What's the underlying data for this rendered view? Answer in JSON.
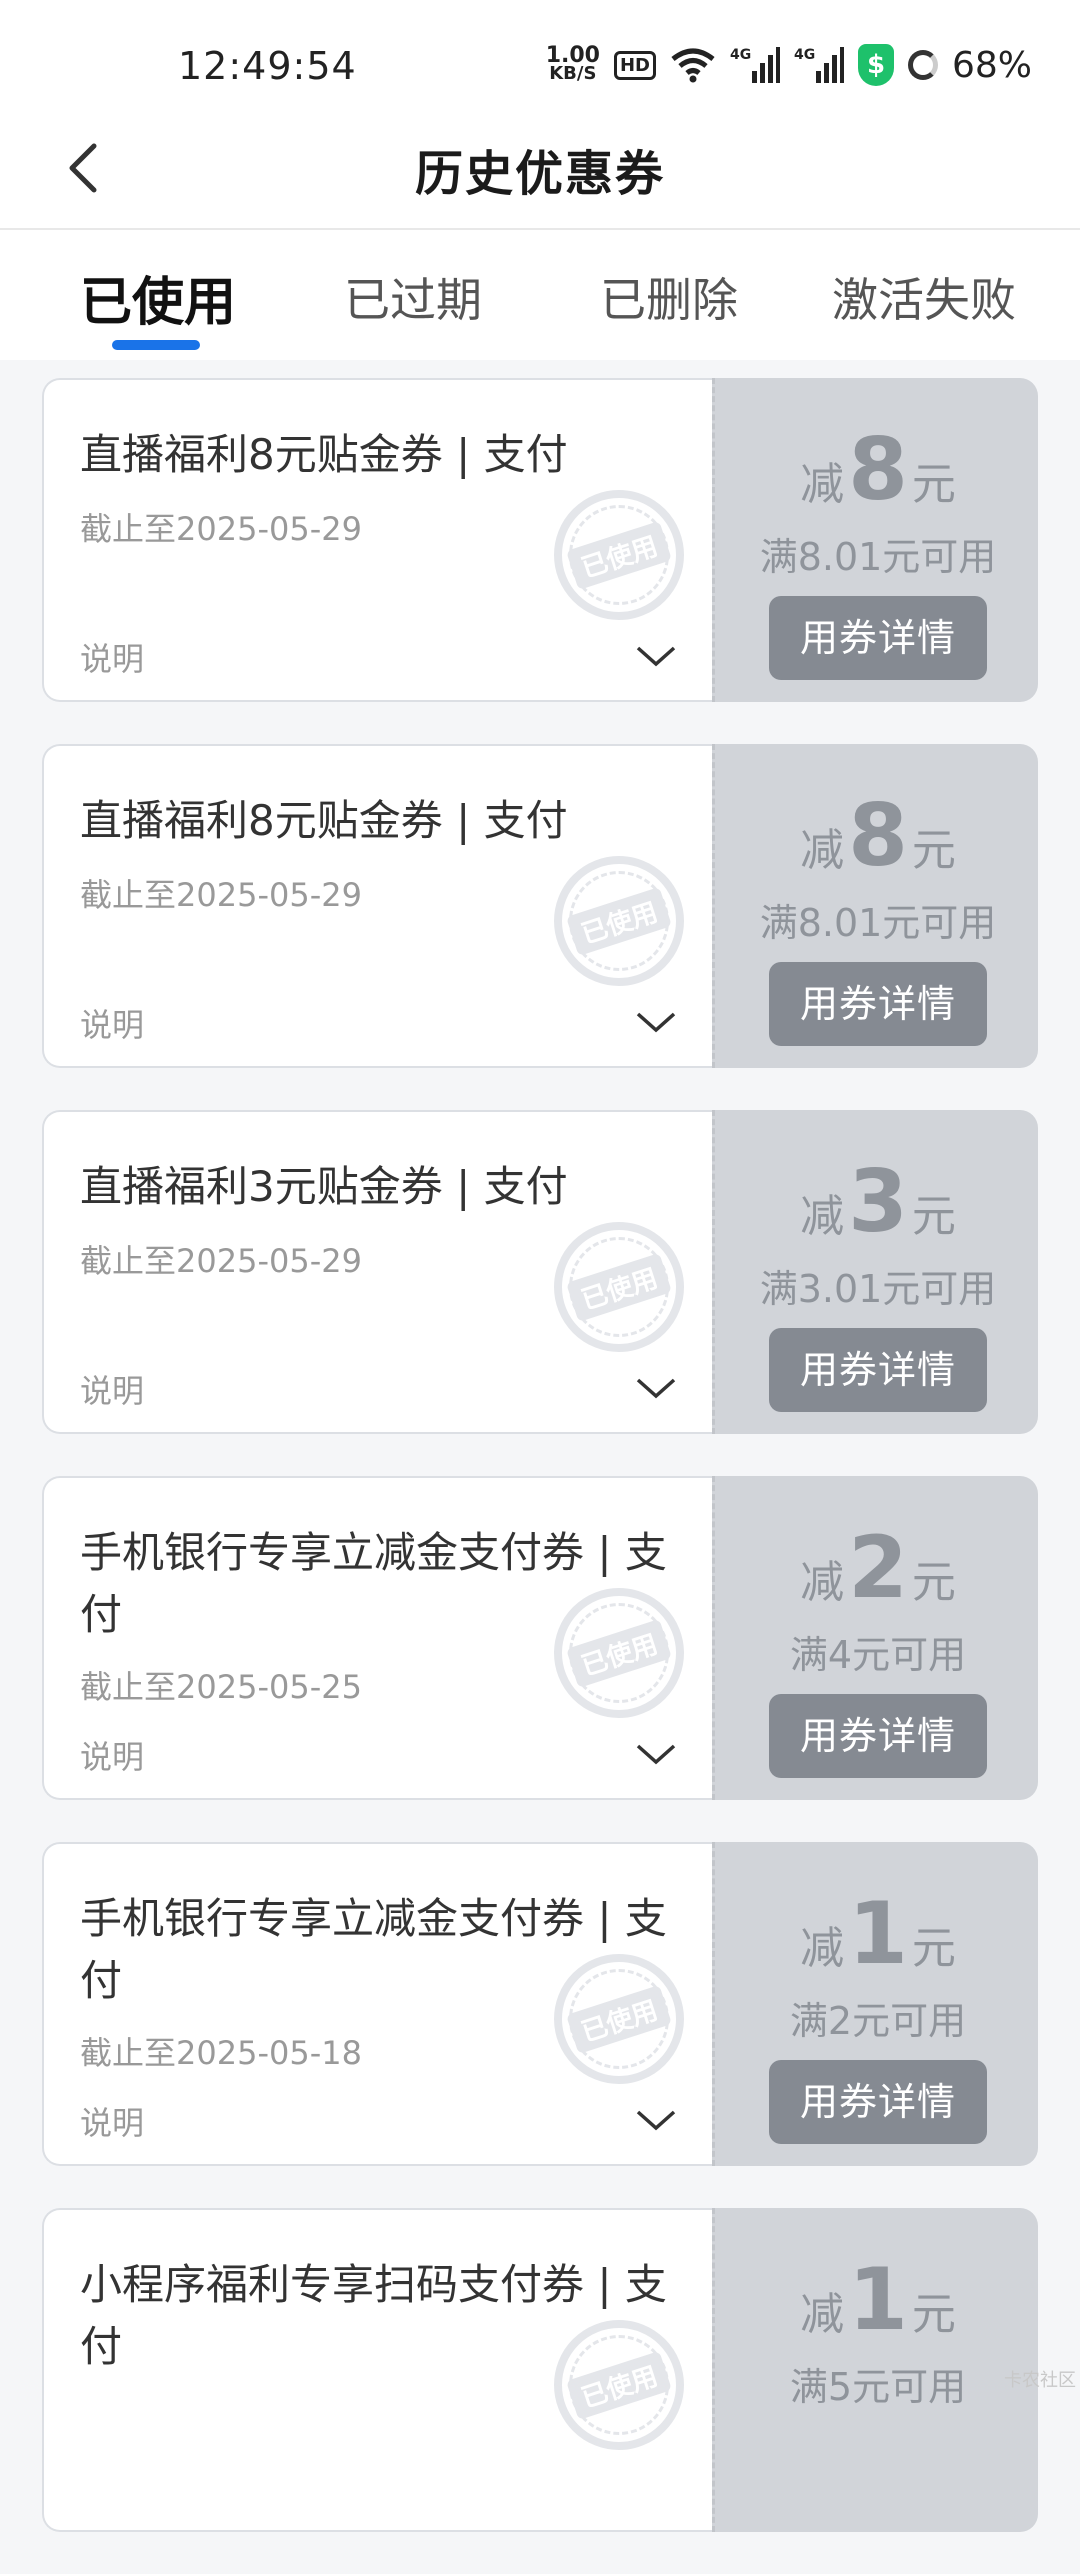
{
  "status": {
    "time": "12:49:54",
    "speed_value": "1.00",
    "speed_unit": "KB/S",
    "hd": "HD",
    "battery": "68%"
  },
  "header": {
    "title": "历史优惠券"
  },
  "tabs": [
    {
      "label": "已使用",
      "active": true
    },
    {
      "label": "已过期",
      "active": false
    },
    {
      "label": "已删除",
      "active": false
    },
    {
      "label": "激活失败",
      "active": false
    }
  ],
  "coupons": [
    {
      "title": "直播福利8元贴金券 | 支付",
      "date": "截止至2025-05-29",
      "note": "说明",
      "stamp": "已使用",
      "prefix": "减",
      "amount": "8",
      "suffix": "元",
      "condition": "满8.01元可用",
      "button": "用券详情"
    },
    {
      "title": "直播福利8元贴金券 | 支付",
      "date": "截止至2025-05-29",
      "note": "说明",
      "stamp": "已使用",
      "prefix": "减",
      "amount": "8",
      "suffix": "元",
      "condition": "满8.01元可用",
      "button": "用券详情"
    },
    {
      "title": "直播福利3元贴金券 | 支付",
      "date": "截止至2025-05-29",
      "note": "说明",
      "stamp": "已使用",
      "prefix": "减",
      "amount": "3",
      "suffix": "元",
      "condition": "满3.01元可用",
      "button": "用券详情"
    },
    {
      "title": "手机银行专享立减金支付券 | 支付",
      "date": "截止至2025-05-25",
      "note": "说明",
      "stamp": "已使用",
      "prefix": "减",
      "amount": "2",
      "suffix": "元",
      "condition": "满4元可用",
      "button": "用券详情"
    },
    {
      "title": "手机银行专享立减金支付券 | 支付",
      "date": "截止至2025-05-18",
      "note": "说明",
      "stamp": "已使用",
      "prefix": "减",
      "amount": "1",
      "suffix": "元",
      "condition": "满2元可用",
      "button": "用券详情"
    },
    {
      "title": "小程序福利专享扫码支付券 | 支付",
      "date": "",
      "note": "",
      "stamp": "已使用",
      "prefix": "减",
      "amount": "1",
      "suffix": "元",
      "condition": "满5元可用",
      "button": ""
    }
  ],
  "watermark": "卡农社区"
}
